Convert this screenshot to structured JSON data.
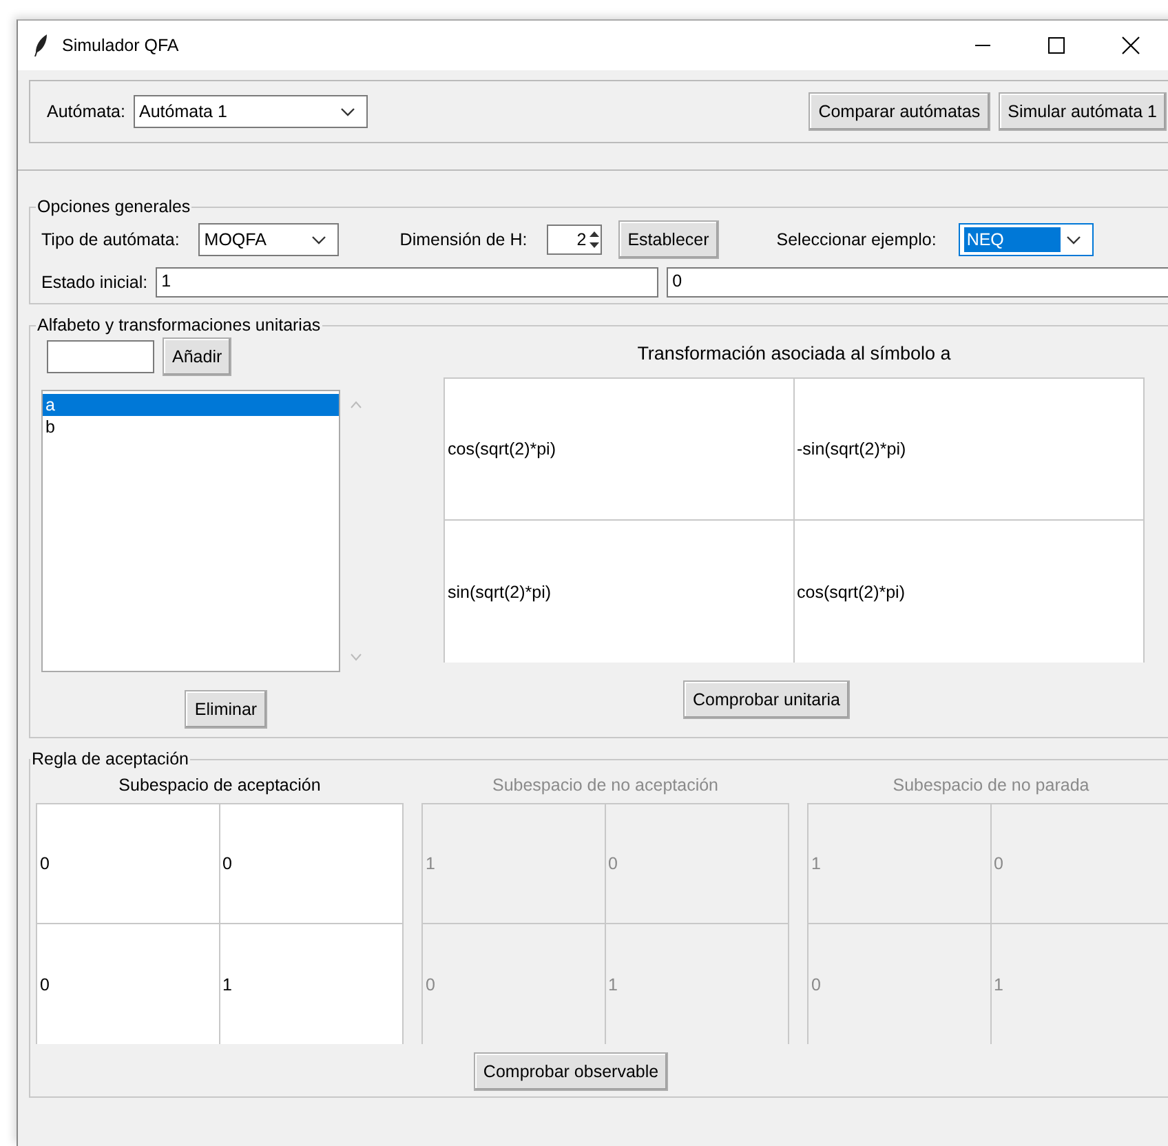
{
  "window": {
    "title": "Simulador QFA"
  },
  "toolbar": {
    "label": "Autómata:",
    "automaton_select": "Autómata 1",
    "buttons": [
      "Comparar autómatas",
      "Simular autómata 1"
    ]
  },
  "general_options": {
    "title": "Opciones generales",
    "type_label": "Tipo de autómata:",
    "type_value": "MOQFA",
    "dimension_label": "Dimensión de H:",
    "dimension_value": "2",
    "set_button": "Establecer",
    "example_label": "Seleccionar ejemplo:",
    "example_value": "NEQ",
    "example_highlighted": true,
    "initial_state_label": "Estado inicial:",
    "initial_state": [
      "1",
      "0"
    ]
  },
  "alphabet": {
    "title": "Alfabeto y transformaciones unitarias",
    "add_button": "Añadir",
    "symbols": [
      {
        "label": "a",
        "selected": true
      },
      {
        "label": "b",
        "selected": false
      }
    ],
    "delete_button": "Eliminar",
    "matrix_title": "Transformación asociada al símbolo a",
    "matrix": [
      [
        "cos(sqrt(2)*pi)",
        "-sin(sqrt(2)*pi)"
      ],
      [
        "sin(sqrt(2)*pi)",
        "cos(sqrt(2)*pi)"
      ]
    ],
    "check_button": "Comprobar unitaria"
  },
  "acceptance": {
    "title": "Regla de aceptación",
    "subspaces": [
      {
        "title": "Subespacio de aceptación",
        "disabled": false,
        "matrix": [
          [
            "0",
            "0"
          ],
          [
            "0",
            "1"
          ]
        ]
      },
      {
        "title": "Subespacio de no aceptación",
        "disabled": true,
        "matrix": [
          [
            "1",
            "0"
          ],
          [
            "0",
            "1"
          ]
        ]
      },
      {
        "title": "Subespacio de no parada",
        "disabled": true,
        "matrix": [
          [
            "1",
            "0"
          ],
          [
            "0",
            "1"
          ]
        ]
      }
    ],
    "check_button": "Comprobar observable"
  }
}
